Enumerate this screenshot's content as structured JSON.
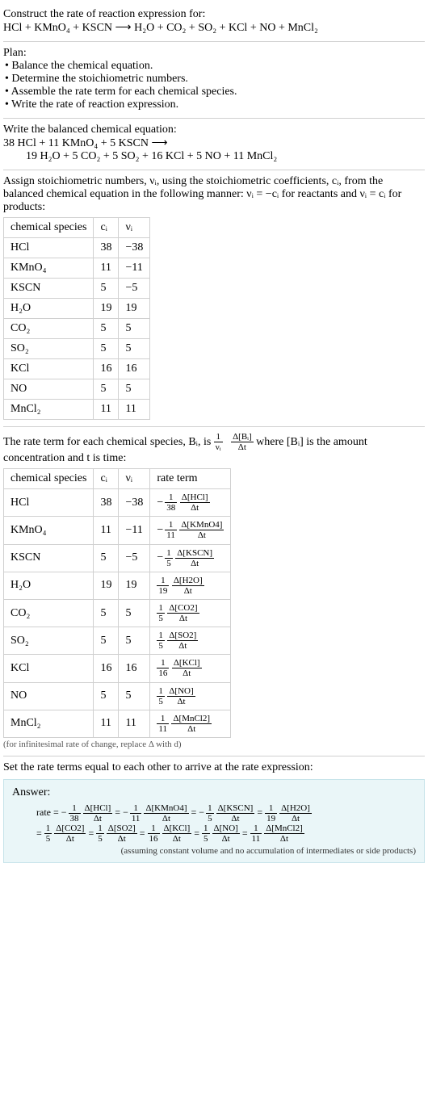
{
  "construct": {
    "title": "Construct the rate of reaction expression for:",
    "equation": "HCl + KMnO₄ + KSCN  ⟶  H₂O + CO₂ + SO₂ + KCl + NO + MnCl₂"
  },
  "plan": {
    "title": "Plan:",
    "items": [
      "• Balance the chemical equation.",
      "• Determine the stoichiometric numbers.",
      "• Assemble the rate term for each chemical species.",
      "• Write the rate of reaction expression."
    ]
  },
  "balance": {
    "title": "Write the balanced chemical equation:",
    "line1": "38 HCl + 11 KMnO₄ + 5 KSCN  ⟶",
    "line2": "19 H₂O + 5 CO₂ + 5 SO₂ + 16 KCl + 5 NO + 11 MnCl₂"
  },
  "assign": {
    "text": "Assign stoichiometric numbers, νᵢ, using the stoichiometric coefficients, cᵢ, from the balanced chemical equation in the following manner: νᵢ = −cᵢ for reactants and νᵢ = cᵢ for products:",
    "headers": [
      "chemical species",
      "cᵢ",
      "νᵢ"
    ],
    "rows": [
      {
        "sp": "HCl",
        "c": "38",
        "v": "−38"
      },
      {
        "sp": "KMnO₄",
        "c": "11",
        "v": "−11"
      },
      {
        "sp": "KSCN",
        "c": "5",
        "v": "−5"
      },
      {
        "sp": "H₂O",
        "c": "19",
        "v": "19"
      },
      {
        "sp": "CO₂",
        "c": "5",
        "v": "5"
      },
      {
        "sp": "SO₂",
        "c": "5",
        "v": "5"
      },
      {
        "sp": "KCl",
        "c": "16",
        "v": "16"
      },
      {
        "sp": "NO",
        "c": "5",
        "v": "5"
      },
      {
        "sp": "MnCl₂",
        "c": "11",
        "v": "11"
      }
    ]
  },
  "rateterm": {
    "pre": "The rate term for each chemical species, Bᵢ, is ",
    "one": "1",
    "nu": "νᵢ",
    "dbi": "Δ[Bᵢ]",
    "dt": "Δt",
    "post": " where [Bᵢ] is the amount concentration and t is time:",
    "headers": [
      "chemical species",
      "cᵢ",
      "νᵢ",
      "rate term"
    ],
    "rows": [
      {
        "sp": "HCl",
        "c": "38",
        "v": "−38",
        "neg": "−",
        "num": "1",
        "den": "38",
        "dnum": "Δ[HCl]",
        "dden": "Δt"
      },
      {
        "sp": "KMnO₄",
        "c": "11",
        "v": "−11",
        "neg": "−",
        "num": "1",
        "den": "11",
        "dnum": "Δ[KMnO4]",
        "dden": "Δt"
      },
      {
        "sp": "KSCN",
        "c": "5",
        "v": "−5",
        "neg": "−",
        "num": "1",
        "den": "5",
        "dnum": "Δ[KSCN]",
        "dden": "Δt"
      },
      {
        "sp": "H₂O",
        "c": "19",
        "v": "19",
        "neg": "",
        "num": "1",
        "den": "19",
        "dnum": "Δ[H2O]",
        "dden": "Δt"
      },
      {
        "sp": "CO₂",
        "c": "5",
        "v": "5",
        "neg": "",
        "num": "1",
        "den": "5",
        "dnum": "Δ[CO2]",
        "dden": "Δt"
      },
      {
        "sp": "SO₂",
        "c": "5",
        "v": "5",
        "neg": "",
        "num": "1",
        "den": "5",
        "dnum": "Δ[SO2]",
        "dden": "Δt"
      },
      {
        "sp": "KCl",
        "c": "16",
        "v": "16",
        "neg": "",
        "num": "1",
        "den": "16",
        "dnum": "Δ[KCl]",
        "dden": "Δt"
      },
      {
        "sp": "NO",
        "c": "5",
        "v": "5",
        "neg": "",
        "num": "1",
        "den": "5",
        "dnum": "Δ[NO]",
        "dden": "Δt"
      },
      {
        "sp": "MnCl₂",
        "c": "11",
        "v": "11",
        "neg": "",
        "num": "1",
        "den": "11",
        "dnum": "Δ[MnCl2]",
        "dden": "Δt"
      }
    ],
    "note": "(for infinitesimal rate of change, replace Δ with d)"
  },
  "setequal": {
    "text": "Set the rate terms equal to each other to arrive at the rate expression:"
  },
  "answer": {
    "title": "Answer:",
    "rate_label": "rate = ",
    "eq": " = ",
    "terms": [
      {
        "neg": "−",
        "num": "1",
        "den": "38",
        "dnum": "Δ[HCl]",
        "dden": "Δt"
      },
      {
        "neg": "−",
        "num": "1",
        "den": "11",
        "dnum": "Δ[KMnO4]",
        "dden": "Δt"
      },
      {
        "neg": "−",
        "num": "1",
        "den": "5",
        "dnum": "Δ[KSCN]",
        "dden": "Δt"
      },
      {
        "neg": "",
        "num": "1",
        "den": "19",
        "dnum": "Δ[H2O]",
        "dden": "Δt"
      },
      {
        "neg": "",
        "num": "1",
        "den": "5",
        "dnum": "Δ[CO2]",
        "dden": "Δt"
      },
      {
        "neg": "",
        "num": "1",
        "den": "5",
        "dnum": "Δ[SO2]",
        "dden": "Δt"
      },
      {
        "neg": "",
        "num": "1",
        "den": "16",
        "dnum": "Δ[KCl]",
        "dden": "Δt"
      },
      {
        "neg": "",
        "num": "1",
        "den": "5",
        "dnum": "Δ[NO]",
        "dden": "Δt"
      },
      {
        "neg": "",
        "num": "1",
        "den": "11",
        "dnum": "Δ[MnCl2]",
        "dden": "Δt"
      }
    ],
    "note": "(assuming constant volume and no accumulation of intermediates or side products)"
  }
}
